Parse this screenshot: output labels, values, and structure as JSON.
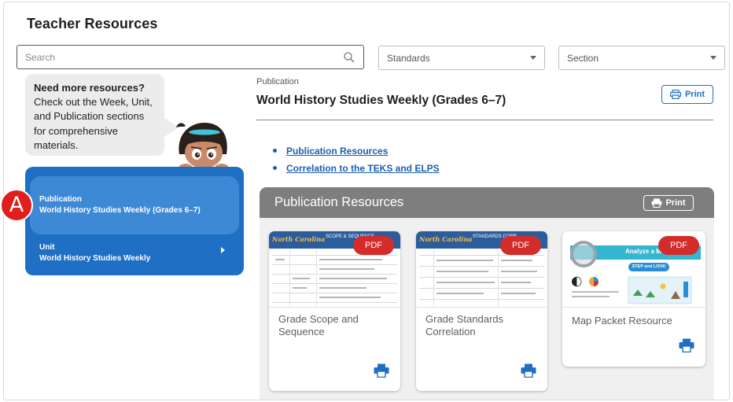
{
  "page": {
    "title": "Teacher Resources"
  },
  "search": {
    "placeholder": "Search"
  },
  "filters": {
    "standards": {
      "value": "Standards"
    },
    "section": {
      "value": "Section"
    }
  },
  "help_bubble": {
    "heading": "Need more resources?",
    "body_lines": [
      "Check out the Week, Unit,",
      "and Publication sections",
      "for comprehensive",
      "materials."
    ]
  },
  "nav": {
    "items": [
      {
        "type_label": "Publication",
        "title": "World History Studies Weekly (Grades 6–7)",
        "active": true
      },
      {
        "type_label": "Unit",
        "title": "World History Studies Weekly",
        "active": false
      }
    ]
  },
  "marker": {
    "label": "A"
  },
  "main": {
    "breadcrumb": "Publication",
    "title": "World History Studies Weekly (Grades 6–7)",
    "print_label": "Print",
    "links": [
      "Publication Resources",
      "Correlation to the TEKS and ELPS"
    ]
  },
  "resources": {
    "heading": "Publication Resources",
    "print_label": "Print",
    "cards": [
      {
        "name": "Grade Scope and Sequence",
        "badge": "PDF",
        "thumb_logo": "North Carolina",
        "thumb_title": "SCOPE & SEQUENCE"
      },
      {
        "name": "Grade Standards Correlation",
        "badge": "PDF",
        "thumb_logo": "North Carolina",
        "thumb_title": "STANDARDS CORR"
      },
      {
        "name": "Map Packet Resource",
        "badge": "PDF",
        "thumb_title": "Analyze a Map",
        "thumb_pill": "STEP and LOOK"
      }
    ]
  },
  "icons": {
    "search": "search-icon",
    "print": "printer-icon",
    "caret": "chevron-down-icon",
    "arrow": "chevron-right-icon"
  },
  "colors": {
    "primary_blue": "#1f6fc4",
    "active_nav": "#3e89d6",
    "pdf_red": "#d42b2b",
    "marker_red": "#e21d1d",
    "panel_header_gray": "#7e7e7e",
    "link_blue": "#1a5fae"
  }
}
